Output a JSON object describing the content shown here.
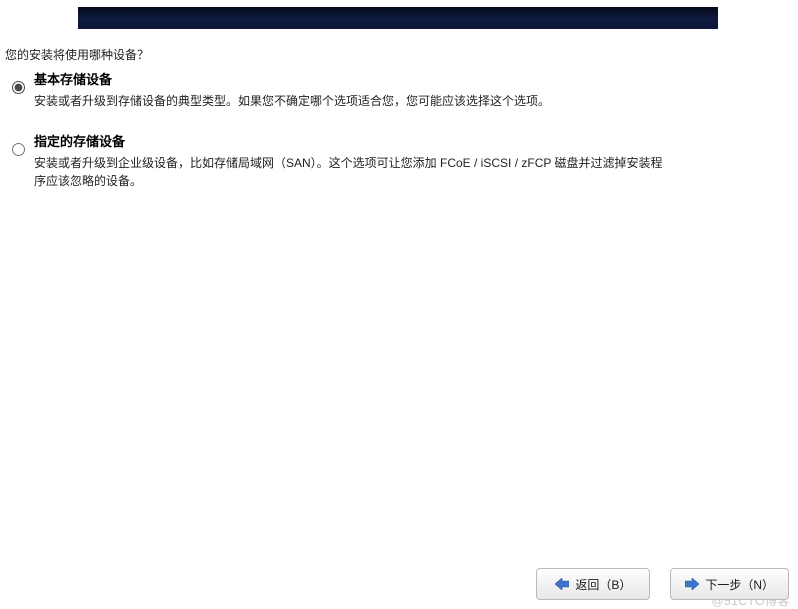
{
  "question": "您的安装将使用哪种设备？",
  "options": [
    {
      "title": "基本存储设备",
      "desc": "安装或者升级到存储设备的典型类型。如果您不确定哪个选项适合您，您可能应该选择这个选项。",
      "selected": true
    },
    {
      "title": "指定的存储设备",
      "desc": "安装或者升级到企业级设备，比如存储局域网（SAN）。这个选项可让您添加 FCoE / iSCSI / zFCP 磁盘并过滤掉安装程序应该忽略的设备。",
      "selected": false
    }
  ],
  "buttons": {
    "back": "返回（B）",
    "next": "下一步（N）"
  },
  "watermark": "@51CTO博客"
}
